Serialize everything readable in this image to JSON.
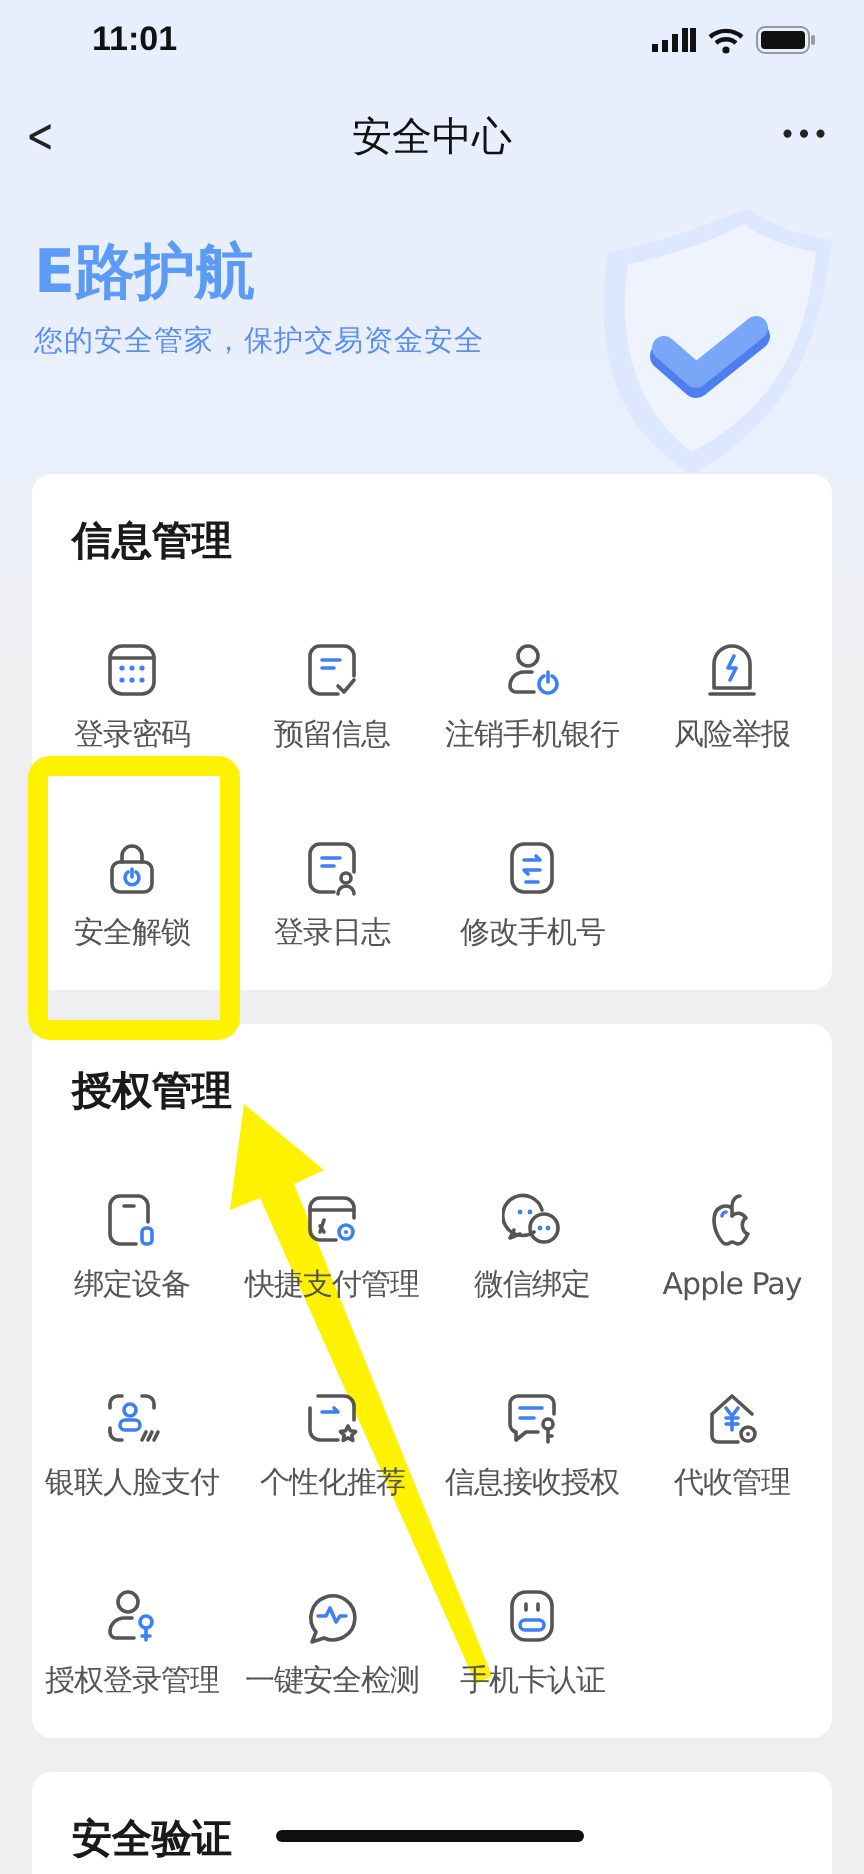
{
  "status_bar": {
    "time": "11:01"
  },
  "nav": {
    "back": "<",
    "title": "安全中心",
    "more": "•••"
  },
  "hero": {
    "title": "E路护航",
    "subtitle": "您的安全管家，保护交易资金安全"
  },
  "sections": [
    {
      "title": "信息管理",
      "items": [
        {
          "label": "登录密码"
        },
        {
          "label": "预留信息"
        },
        {
          "label": "注销手机银行"
        },
        {
          "label": "风险举报"
        },
        {
          "label": "安全解锁"
        },
        {
          "label": "登录日志"
        },
        {
          "label": "修改手机号"
        }
      ]
    },
    {
      "title": "授权管理",
      "items": [
        {
          "label": "绑定设备"
        },
        {
          "label": "快捷支付管理"
        },
        {
          "label": "微信绑定"
        },
        {
          "label": "Apple Pay"
        },
        {
          "label": "银联人脸支付"
        },
        {
          "label": "个性化推荐"
        },
        {
          "label": "信息接收授权"
        },
        {
          "label": "代收管理"
        },
        {
          "label": "授权登录管理"
        },
        {
          "label": "一键安全检测"
        },
        {
          "label": "手机卡认证"
        }
      ]
    },
    {
      "title": "安全验证"
    }
  ]
}
